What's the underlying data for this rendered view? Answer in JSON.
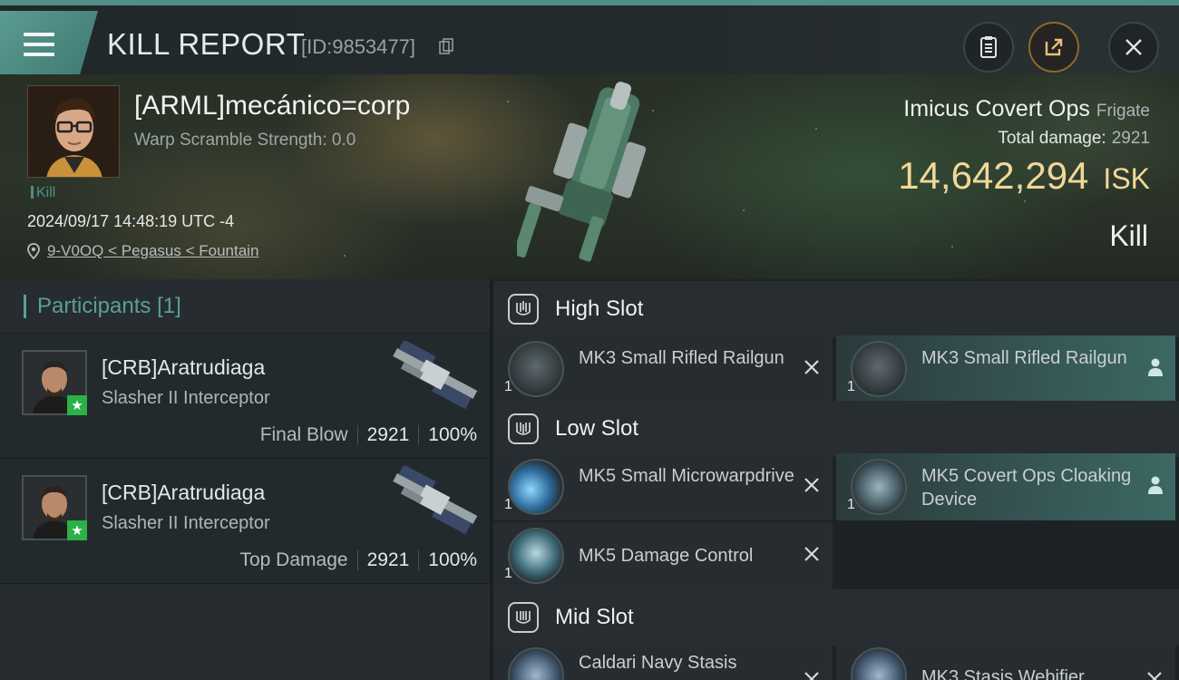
{
  "header": {
    "title": "KILL REPORT",
    "id_text": "[ID:9853477]"
  },
  "victim": {
    "name": "[ARML]mecánico=corp",
    "warp_scramble": "Warp Scramble Strength: 0.0",
    "tag": "Kill",
    "datetime": "2024/09/17 14:48:19 UTC -4",
    "location": "9-V0OQ < Pegasus < Fountain"
  },
  "ship": {
    "name": "Imicus Covert Ops",
    "class": "Frigate",
    "total_damage_label": "Total damage:",
    "total_damage": "2921",
    "isk_value": "14,642,294",
    "isk_unit": "ISK",
    "result": "Kill"
  },
  "participants": {
    "title": "Participants",
    "count": "[1]",
    "rows": [
      {
        "name": "[CRB]Aratrudiaga",
        "ship": "Slasher II Interceptor",
        "label": "Final Blow",
        "damage": "2921",
        "percent": "100%"
      },
      {
        "name": "[CRB]Aratrudiaga",
        "ship": "Slasher II Interceptor",
        "label": "Top Damage",
        "damage": "2921",
        "percent": "100%"
      }
    ]
  },
  "slots": {
    "high": {
      "label": "High Slot",
      "modules": [
        {
          "name": "MK3 Small Rifled Railgun",
          "qty": "1",
          "status": "destroyed"
        },
        {
          "name": "MK3 Small Rifled Railgun",
          "qty": "1",
          "status": "dropped"
        }
      ]
    },
    "low": {
      "label": "Low Slot",
      "modules": [
        {
          "name": "MK5 Small Microwarpdrive",
          "qty": "1",
          "status": "destroyed"
        },
        {
          "name": "MK5 Covert Ops Cloaking Device",
          "qty": "1",
          "status": "dropped"
        },
        {
          "name": "MK5 Damage Control",
          "qty": "1",
          "status": "destroyed"
        }
      ]
    },
    "mid": {
      "label": "Mid Slot",
      "modules": [
        {
          "name": "Caldari Navy Stasis",
          "qty": "",
          "status": "destroyed"
        },
        {
          "name": "MK3 Stasis Webifier",
          "qty": "",
          "status": "destroyed"
        }
      ]
    }
  },
  "colors": {
    "accent": "#4f8f87",
    "isk": "#f0d89a",
    "background": "#1d2225"
  }
}
